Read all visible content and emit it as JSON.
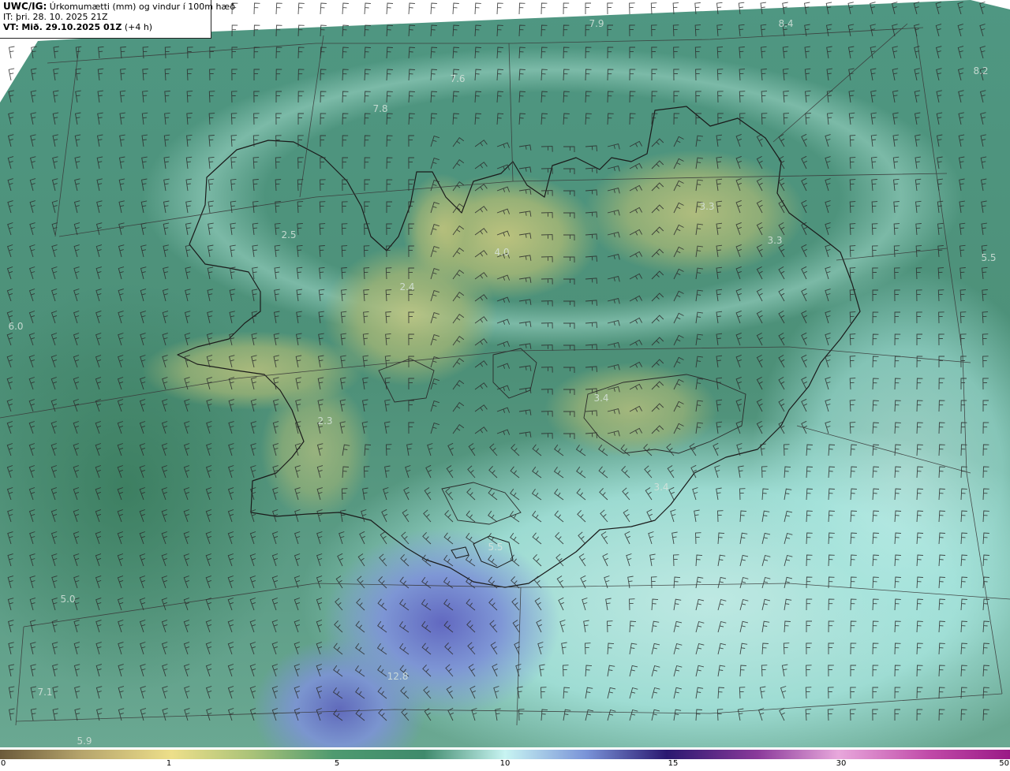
{
  "info": {
    "model": "UWC/IG:",
    "title": "Úrkomumætti (mm) og vindur í 100m hæð",
    "it_label": "IT:",
    "it_value": "þri. 28. 10. 2025 21Z",
    "vt_label": "VT:",
    "vt_value": "Mið. 29.10.2025 01Z",
    "vt_offset": "(+4 h)"
  },
  "labels": [
    {
      "text": "7.9"
    },
    {
      "text": "8.4"
    },
    {
      "text": "7.6"
    },
    {
      "text": "7.8"
    },
    {
      "text": "8.2"
    },
    {
      "text": "3.3"
    },
    {
      "text": "3.3"
    },
    {
      "text": "5.5"
    },
    {
      "text": "2.5"
    },
    {
      "text": "2.4"
    },
    {
      "text": "4.0"
    },
    {
      "text": "6.0"
    },
    {
      "text": "3.4"
    },
    {
      "text": "2.3"
    },
    {
      "text": "3.4"
    },
    {
      "text": "5.5"
    },
    {
      "text": "5.0"
    },
    {
      "text": "12.8"
    },
    {
      "text": "7.1"
    },
    {
      "text": "5.9"
    }
  ],
  "colorbar": {
    "ticks": [
      "0",
      "1",
      "5",
      "10",
      "15",
      "30",
      "50"
    ],
    "colors": [
      "#6b5a3a",
      "#c9b878",
      "#eddf8a",
      "#a9c278",
      "#5f9e6e",
      "#3f8a6c",
      "#6fb7a7",
      "#c8f4f2",
      "#7a94d8",
      "#3a3aa6",
      "#2a1870",
      "#8a3a9a",
      "#e8a8dc",
      "#c04aa8",
      "#9a1a86"
    ]
  }
}
